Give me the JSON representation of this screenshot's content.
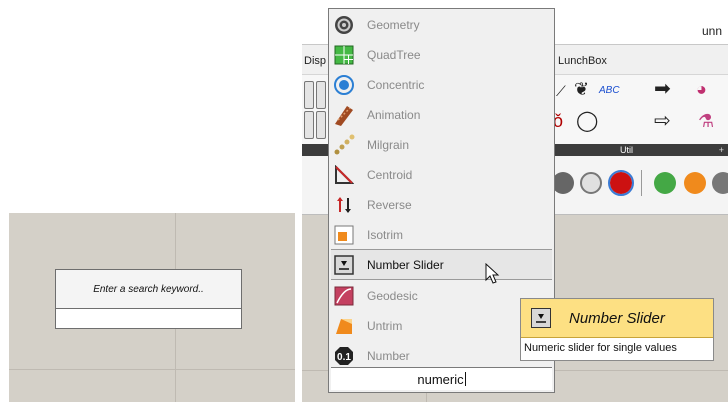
{
  "left_panel": {
    "search_placeholder": "Enter a search keyword.."
  },
  "app": {
    "window_title": "unn",
    "tabs": [
      "Disp",
      "LunchBox"
    ],
    "ribbon_group_label": "Util",
    "ribbon_group_plus": "+"
  },
  "dropdown": {
    "items": [
      {
        "label": "Geometry",
        "icon": "geometry-icon"
      },
      {
        "label": "QuadTree",
        "icon": "quadtree-icon"
      },
      {
        "label": "Concentric",
        "icon": "concentric-icon"
      },
      {
        "label": "Animation",
        "icon": "animation-icon"
      },
      {
        "label": "Milgrain",
        "icon": "milgrain-icon"
      },
      {
        "label": "Centroid",
        "icon": "centroid-icon"
      },
      {
        "label": "Reverse",
        "icon": "reverse-icon"
      },
      {
        "label": "Isotrim",
        "icon": "isotrim-icon"
      },
      {
        "label": "Number Slider",
        "icon": "number-slider-icon"
      },
      {
        "label": "Geodesic",
        "icon": "geodesic-icon"
      },
      {
        "label": "Untrim",
        "icon": "untrim-icon"
      },
      {
        "label": "Number",
        "icon": "number-icon"
      }
    ],
    "selected_index": 8,
    "search_value": "numeric"
  },
  "tooltip": {
    "title": "Number Slider",
    "description": "Numeric slider for single values",
    "background": "#fde083"
  },
  "colors": {
    "canvas": "#d4d0c8",
    "ribbon_dark": "#3c3c3c",
    "tooltip_yellow": "#fde083"
  }
}
